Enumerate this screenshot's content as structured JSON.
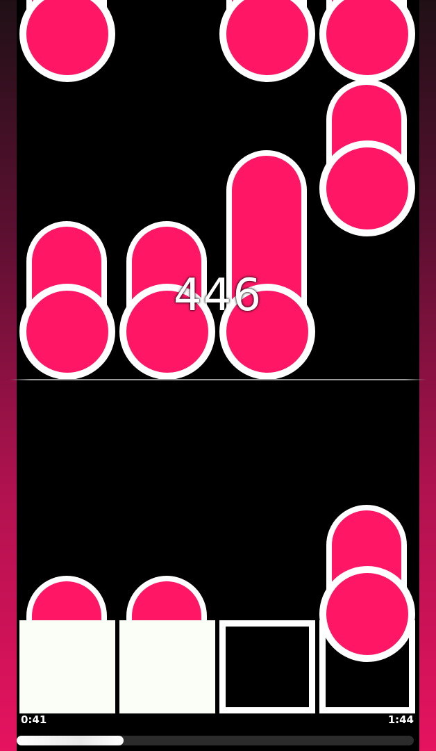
{
  "game": {
    "score": "446",
    "time_elapsed": "0:41",
    "time_total": "1:44",
    "progress": 0.27,
    "lanes": 4,
    "pads": [
      {
        "lane": 1,
        "state": "pressed"
      },
      {
        "lane": 2,
        "state": "pressed"
      },
      {
        "lane": 3,
        "state": "idle"
      },
      {
        "lane": 4,
        "state": "idle"
      }
    ]
  },
  "colors": {
    "note": "#ff1766",
    "outline": "#ffffff",
    "background": "#000000",
    "side_gradient_top": "#201016",
    "side_gradient_bottom": "#e6135f"
  }
}
